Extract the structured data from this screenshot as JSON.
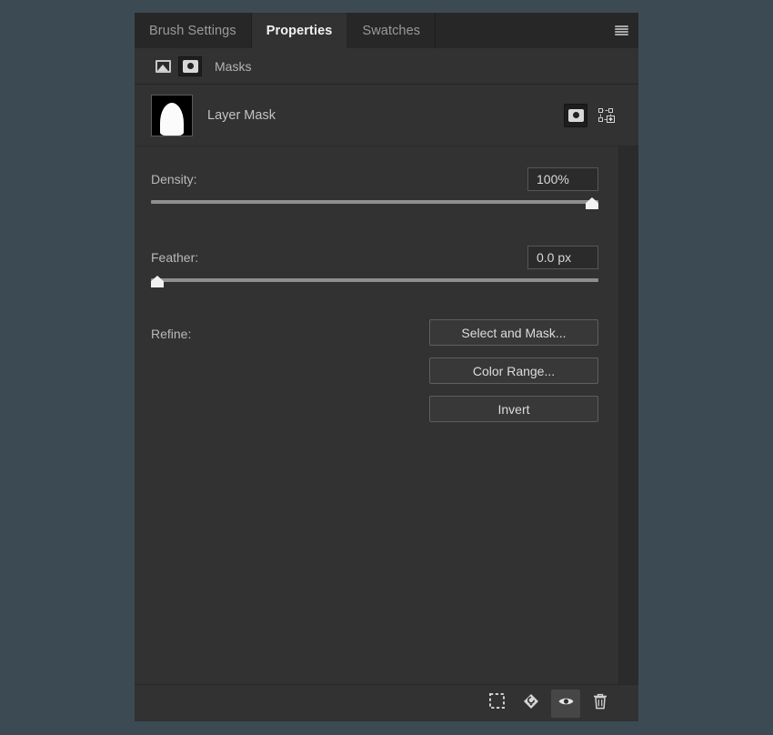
{
  "app": {
    "panel_bg": "#323232",
    "page_bg": "#3c4b53",
    "accent_text": "#f2f2f2"
  },
  "tabs": [
    {
      "label": "Brush Settings",
      "active": false
    },
    {
      "label": "Properties",
      "active": true
    },
    {
      "label": "Swatches",
      "active": false
    }
  ],
  "panel_menu": {
    "icon": "hamburger-menu-icon"
  },
  "subheader": {
    "label": "Masks",
    "image_icon": "image-icon",
    "mask_icon": "mask-icon"
  },
  "mask_row": {
    "title": "Layer Mask",
    "thumbnail": "layer-mask-thumbnail",
    "pixel_mask_icon": "pixel-mask-icon",
    "vector_mask_icon": "vector-mask-icon"
  },
  "controls": {
    "density": {
      "label": "Density:",
      "value": "100%",
      "slider_percent": 100
    },
    "feather": {
      "label": "Feather:",
      "value": "0.0 px",
      "slider_percent": 0
    },
    "refine": {
      "label": "Refine:",
      "buttons": [
        {
          "label": "Select and Mask..."
        },
        {
          "label": "Color Range..."
        },
        {
          "label": "Invert"
        }
      ]
    }
  },
  "footer": {
    "buttons": [
      {
        "icon": "load-selection-icon",
        "active": false
      },
      {
        "icon": "apply-mask-icon",
        "active": false
      },
      {
        "icon": "toggle-mask-visibility-icon",
        "active": true
      },
      {
        "icon": "delete-mask-icon",
        "active": false
      }
    ]
  }
}
